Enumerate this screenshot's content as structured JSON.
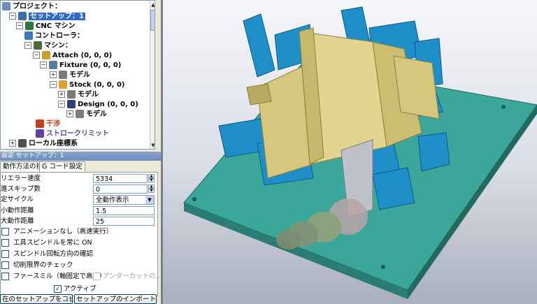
{
  "tree": {
    "items": [
      {
        "label": "プロジェクト：",
        "expander": "",
        "icon": "project-icon"
      },
      {
        "label": "セットアップ：1",
        "expander": "−",
        "icon": "setup-icon"
      },
      {
        "label": "CNC マシン",
        "expander": "−",
        "icon": "cnc-machine-icon"
      },
      {
        "label": "コントローラ：",
        "expander": "",
        "icon": "controller-icon"
      },
      {
        "label": "マシン：",
        "expander": "−",
        "icon": "machine-icon"
      },
      {
        "label": "Attach (0, 0, 0)",
        "expander": "−",
        "icon": "attach-icon"
      },
      {
        "label": "Fixture (0, 0, 0)",
        "expander": "−",
        "icon": "fixture-icon"
      },
      {
        "label": "モデル",
        "expander": "+",
        "icon": "model-icon"
      },
      {
        "label": "Stock (0, 0, 0)",
        "expander": "−",
        "icon": "stock-icon"
      },
      {
        "label": "モデル",
        "expander": "+",
        "icon": "model-icon"
      },
      {
        "label": "Design (0, 0, 0)",
        "expander": "−",
        "icon": "design-icon"
      },
      {
        "label": "モデル",
        "expander": "+",
        "icon": "model-icon"
      },
      {
        "label": "干渉",
        "expander": "",
        "icon": "collision-icon"
      },
      {
        "label": "ストロークリミット",
        "expander": "",
        "icon": "stroke-limit-icon"
      },
      {
        "label": "ローカル座標系",
        "expander": "+",
        "icon": "local-coordinate-icon"
      }
    ]
  },
  "panel": {
    "header": "設定 セットアップ：1",
    "tabs": [
      "動作方法の指定",
      "G コード設定"
    ]
  },
  "form": {
    "error_speed_label": "リエラー速度",
    "error_speed_value": "5334",
    "skip_count_label": "進スキップ数",
    "skip_count_value": "0",
    "cycle_label": "定サイクル",
    "cycle_value": "全動作表示",
    "min_move_label": "小動作距離",
    "min_move_value": "1.5",
    "max_move_label": "大動作距離",
    "max_move_value": "25",
    "options": [
      {
        "label": "アニメーションなし（高速実行）",
        "checked": false
      },
      {
        "label": "工具スピンドルを常に ON",
        "checked": false
      },
      {
        "label": "スピンドル回転方向の確認",
        "checked": false
      },
      {
        "label": "切削限界のチェック",
        "checked": false
      }
    ],
    "face_mill_label": "ファースミル（軸固定で高速）",
    "undercut_label": "アンダーカットの...",
    "active_label": "アクティブ",
    "active_checked": true
  },
  "buttons": {
    "copy_setup": "在のセットアップをコピー",
    "import_setup": "セットアップのインポート..."
  },
  "colors": {
    "base_plate": "#3aa79a",
    "clamps": "#1e8fc8",
    "workpiece": "#d6c77e",
    "selection": "#316ac5"
  }
}
